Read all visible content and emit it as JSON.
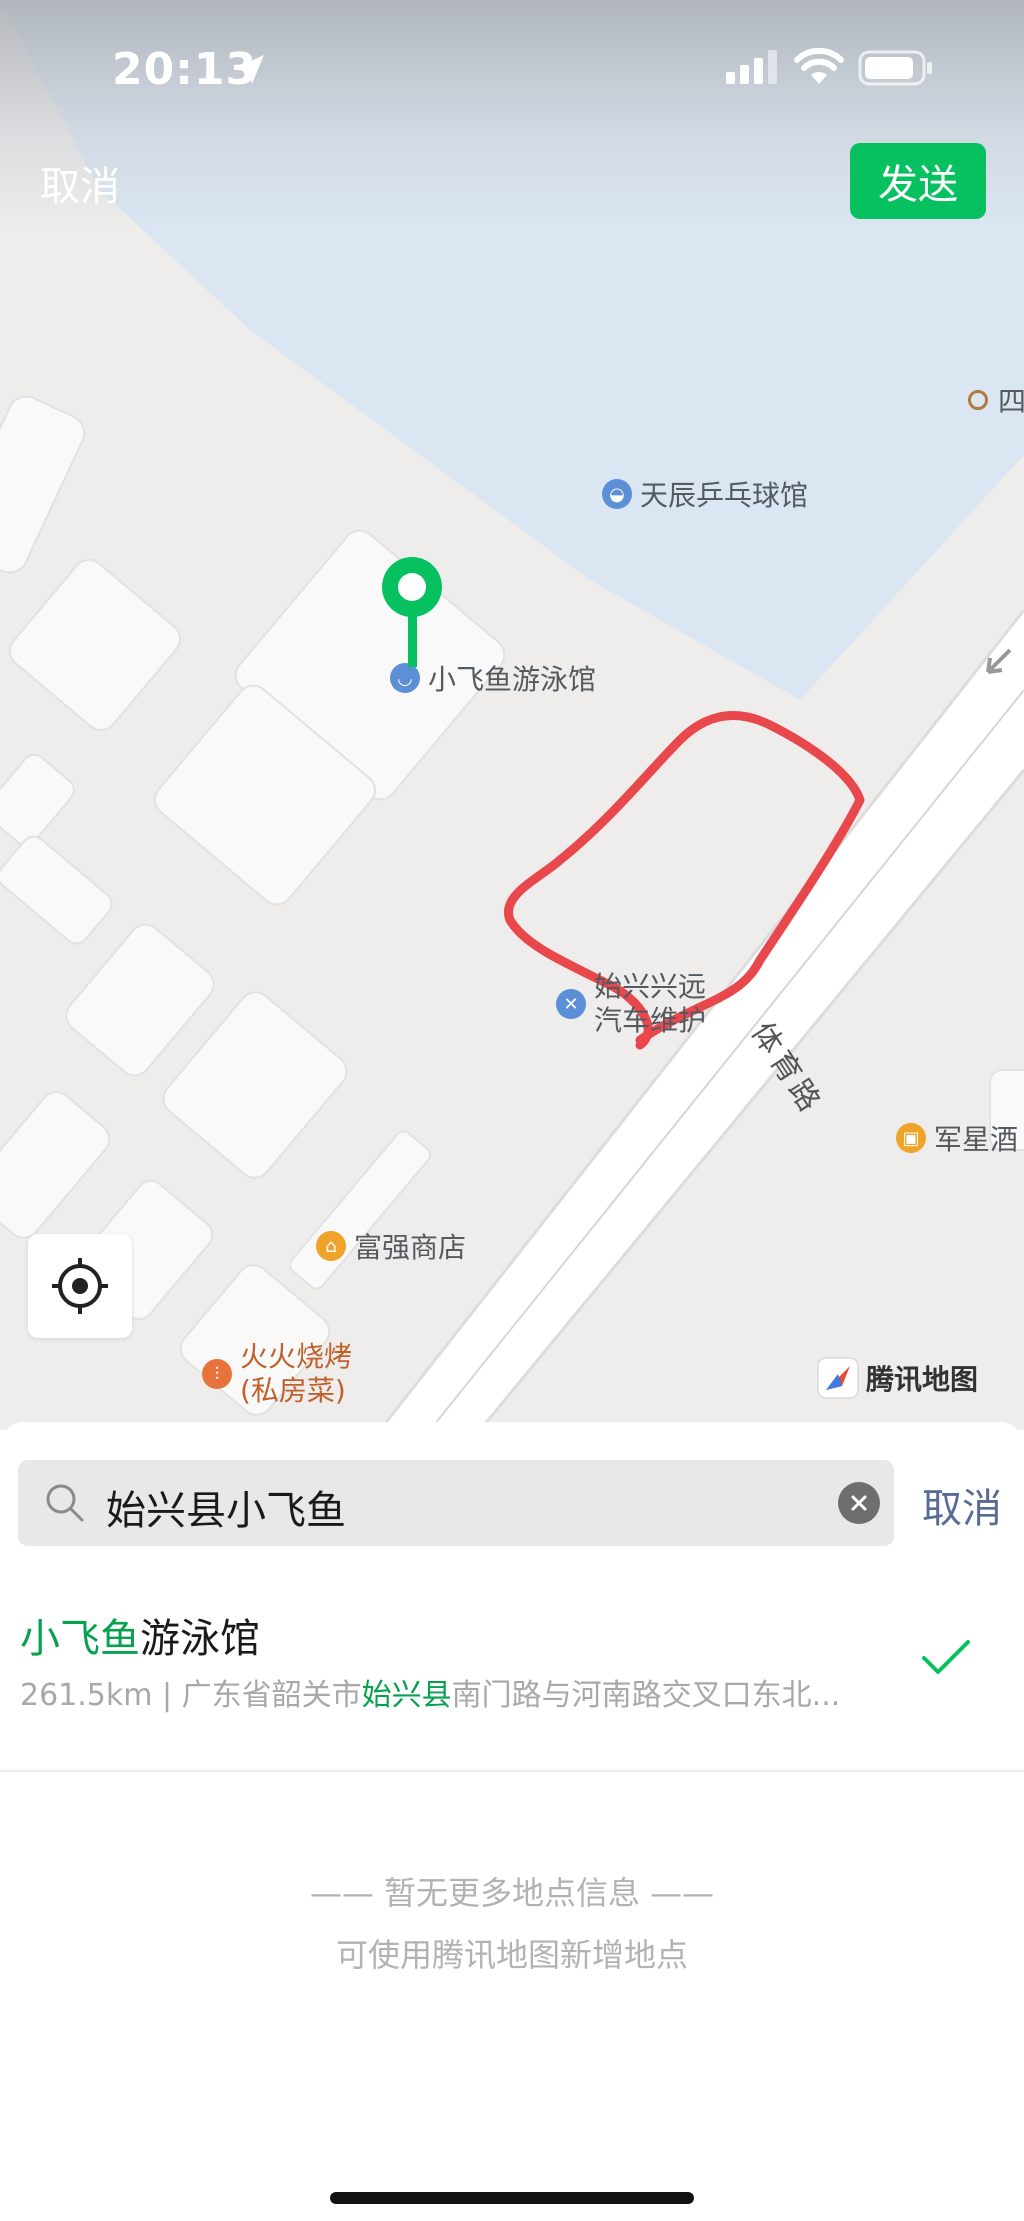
{
  "status_bar": {
    "time": "20:13"
  },
  "nav": {
    "cancel_label": "取消",
    "send_label": "发送"
  },
  "map": {
    "pois": {
      "edge_partial": "四",
      "tiancheng": "天辰乒乓球馆",
      "xiaofeiyu": "小飞鱼游泳馆",
      "shixing_line1": "始兴兴远",
      "shixing_line2": "汽车维护",
      "junxing": "军星酒",
      "fuqiang": "富强商店",
      "huohuo_line1": "火火烧烤",
      "huohuo_line2": "(私房菜)"
    },
    "road_name": "体育路",
    "brand": "腾讯地图",
    "colors": {
      "water": "#dbe6f3",
      "land": "#eeedeb",
      "pin": "#07c160",
      "annotation": "#e8474c"
    }
  },
  "search": {
    "value": "始兴县小飞鱼",
    "cancel_label": "取消"
  },
  "results": [
    {
      "title_highlight": "小飞鱼",
      "title_rest": "游泳馆",
      "addr_prefix": "261.5km | 广东省韶关市",
      "addr_highlight": "始兴县",
      "addr_rest": "南门路与河南路交叉口东北...",
      "selected": true
    }
  ],
  "empty_state": {
    "line1": "—— 暂无更多地点信息 ——",
    "line2": "可使用腾讯地图新增地点"
  }
}
